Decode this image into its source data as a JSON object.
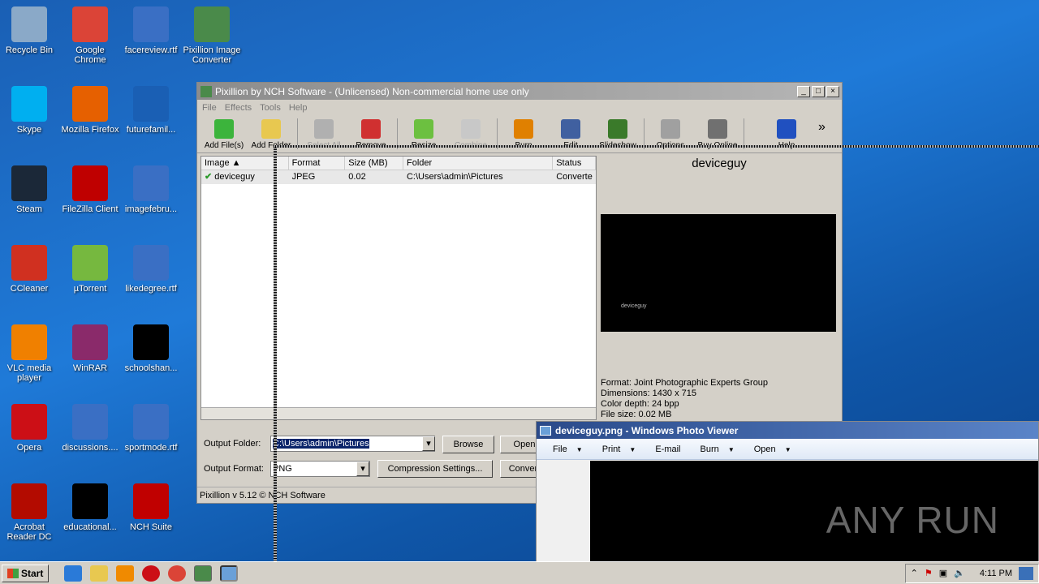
{
  "desktop_icons": [
    {
      "label": "Recycle Bin",
      "color": "#8aa9c8"
    },
    {
      "label": "Google Chrome",
      "color": "#db4437"
    },
    {
      "label": "facereview.rtf",
      "color": "#3a6fc4"
    },
    {
      "label": "Pixillion Image Converter",
      "color": "#4a8a4a"
    },
    {
      "label": "Skype",
      "color": "#00aff0"
    },
    {
      "label": "Mozilla Firefox",
      "color": "#e66000"
    },
    {
      "label": "futurefamil...",
      "color": "#1a5fb4"
    },
    {
      "label": "Steam",
      "color": "#1b2838"
    },
    {
      "label": "FileZilla Client",
      "color": "#bf0000"
    },
    {
      "label": "imagefebru...",
      "color": "#3a6fc4"
    },
    {
      "label": "CCleaner",
      "color": "#d03020"
    },
    {
      "label": "µTorrent",
      "color": "#76b83f"
    },
    {
      "label": "likedegree.rtf",
      "color": "#3a6fc4"
    },
    {
      "label": "VLC media player",
      "color": "#f08000"
    },
    {
      "label": "WinRAR",
      "color": "#8a2a6a"
    },
    {
      "label": "schoolshan...",
      "color": "#000000"
    },
    {
      "label": "Opera",
      "color": "#cc0f16"
    },
    {
      "label": "discussions....",
      "color": "#3a6fc4"
    },
    {
      "label": "sportmode.rtf",
      "color": "#3a6fc4"
    },
    {
      "label": "Acrobat Reader DC",
      "color": "#b30b00"
    },
    {
      "label": "educational...",
      "color": "#000000"
    },
    {
      "label": "NCH Suite",
      "color": "#c00000"
    }
  ],
  "pixillion": {
    "title": "Pixillion by NCH Software - (Unlicensed) Non-commercial home use only",
    "menu": [
      "File",
      "Effects",
      "Tools",
      "Help"
    ],
    "toolbar": [
      {
        "label": "Add File(s)",
        "icon": "plus-icon",
        "color": "#3cb43c",
        "enabled": true
      },
      {
        "label": "Add Folder",
        "icon": "folder-add-icon",
        "color": "#e8c850",
        "enabled": true
      },
      {
        "label": "Select All",
        "icon": "select-all-icon",
        "color": "#b0b0b0",
        "enabled": false
      },
      {
        "label": "Remove",
        "icon": "remove-icon",
        "color": "#d03030",
        "enabled": true
      },
      {
        "label": "Resize",
        "icon": "resize-icon",
        "color": "#6cc040",
        "enabled": true
      },
      {
        "label": "Combine",
        "icon": "combine-icon",
        "color": "#c8c8c8",
        "enabled": false
      },
      {
        "label": "Burn",
        "icon": "burn-icon",
        "color": "#e08000",
        "enabled": true
      },
      {
        "label": "Edit",
        "icon": "edit-icon",
        "color": "#4060a0",
        "enabled": true
      },
      {
        "label": "Slideshow",
        "icon": "slideshow-icon",
        "color": "#3a7a2a",
        "enabled": true
      },
      {
        "label": "Options",
        "icon": "options-icon",
        "color": "#a0a0a0",
        "enabled": true
      },
      {
        "label": "Buy Online",
        "icon": "cart-icon",
        "color": "#707070",
        "enabled": true
      },
      {
        "label": "Help",
        "icon": "help-icon",
        "color": "#2050c0",
        "enabled": true
      }
    ],
    "more": "»",
    "columns": [
      "Image",
      "Format",
      "Size (MB)",
      "Folder",
      "Status"
    ],
    "rows": [
      {
        "image": "deviceguy",
        "format": "JPEG",
        "size": "0.02",
        "folder": "C:\\Users\\admin\\Pictures",
        "status": "Converte"
      }
    ],
    "preview": {
      "name": "deviceguy",
      "thumb_text": "deviceguy",
      "format": "Format: Joint Photographic Experts Group",
      "dimensions": "Dimensions: 1430 x 715",
      "depth": "Color depth: 24 bpp",
      "filesize": "File size: 0.02 MB"
    },
    "output_folder_label": "Output Folder:",
    "output_folder": "C:\\Users\\admin\\Pictures",
    "browse": "Browse",
    "open": "Open",
    "output_format_label": "Output Format:",
    "output_format": "PNG",
    "compression": "Compression Settings...",
    "convert": "Convert",
    "status": "Pixillion v 5.12 © NCH Software"
  },
  "photo_viewer": {
    "title": "deviceguy.png - Windows Photo Viewer",
    "menu": [
      "File",
      "Print",
      "E-mail",
      "Burn",
      "Open"
    ],
    "watermark": "ANY RUN"
  },
  "taskbar": {
    "start": "Start",
    "time": "4:11 PM"
  }
}
